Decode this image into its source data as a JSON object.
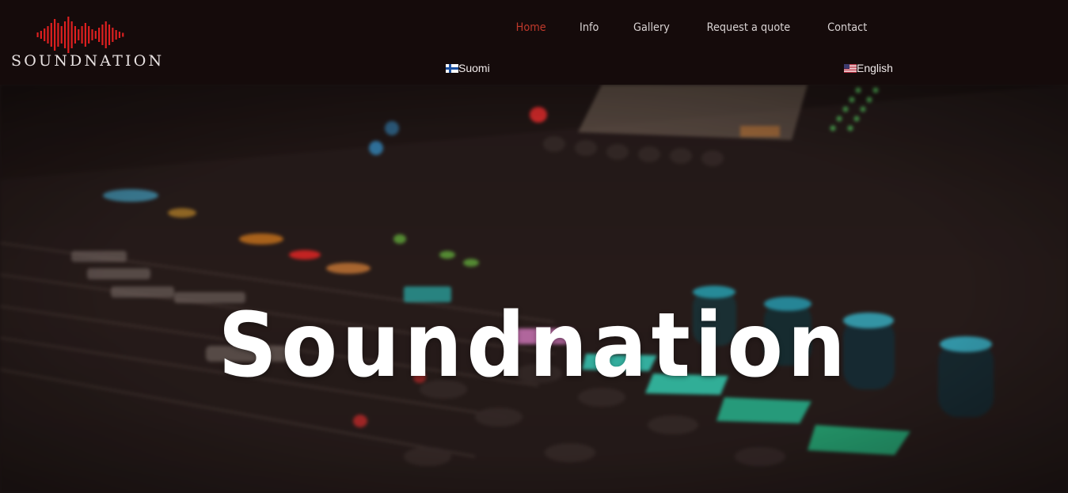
{
  "brand": {
    "logo_text": "SOUNDNATION",
    "accent_color": "#e02020",
    "logo_icon": "soundwave-icon"
  },
  "nav": {
    "items": [
      {
        "label": "Home",
        "active": true
      },
      {
        "label": "Info",
        "active": false
      },
      {
        "label": "Gallery",
        "active": false
      },
      {
        "label": "Request a quote",
        "active": false
      },
      {
        "label": "Contact",
        "active": false
      }
    ],
    "active_color": "#c0392b"
  },
  "languages": [
    {
      "label": "Suomi",
      "flag": "finland-flag-icon"
    },
    {
      "label": "English",
      "flag": "us-flag-icon"
    }
  ],
  "hero": {
    "title": "Soundnation",
    "background": "mixing-console-photo"
  }
}
